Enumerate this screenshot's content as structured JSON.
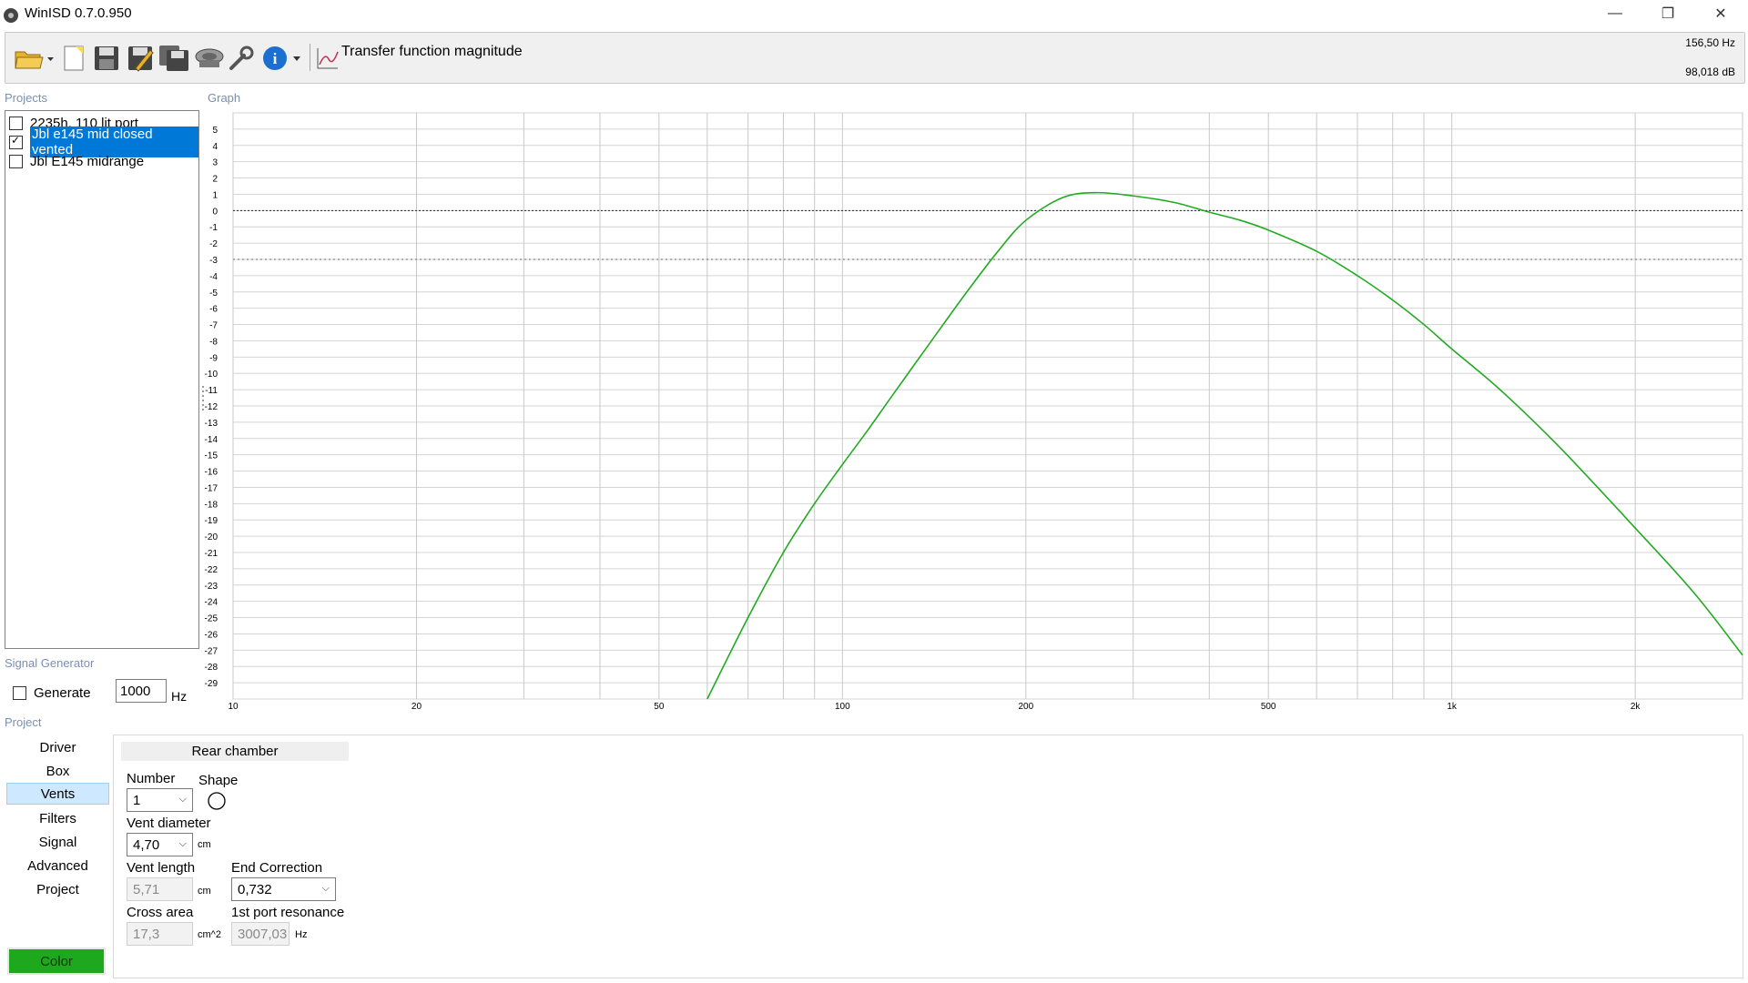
{
  "window": {
    "title": "WinISD 0.7.0.950",
    "minimize": "—",
    "maximize": "❐",
    "close": "✕"
  },
  "toolbar": {
    "graph_type": "Transfer function magnitude",
    "readout_freq": "156,50 Hz",
    "readout_db": "98,018 dB",
    "icons": [
      "open-folder-icon",
      "new-document-icon",
      "save-icon",
      "save-as-icon",
      "save-all-icon",
      "driver-icon",
      "tools-icon",
      "info-icon",
      "graph-type-icon"
    ]
  },
  "projects": {
    "label": "Projects",
    "items": [
      {
        "name": "2235h. 110 lit port",
        "checked": false,
        "selected": false
      },
      {
        "name": "Jbl e145 mid closed vented",
        "checked": true,
        "selected": true
      },
      {
        "name": "Jbl E145 midrange",
        "checked": false,
        "selected": false
      }
    ]
  },
  "graph": {
    "label": "Graph",
    "line_color": "#22aa22"
  },
  "signal_generator": {
    "label": "Signal Generator",
    "generate_label": "Generate",
    "frequency": "1000",
    "unit": "Hz"
  },
  "project_panel": {
    "label": "Project",
    "nav": [
      "Driver",
      "Box",
      "Vents",
      "Filters",
      "Signal",
      "Advanced",
      "Project"
    ],
    "active": "Vents",
    "color_button": "Color",
    "color_value": "#1ea81e"
  },
  "vents": {
    "header": "Rear chamber",
    "number_label": "Number",
    "number_value": "1",
    "shape_label": "Shape",
    "diameter_label": "Vent diameter",
    "diameter_value": "4,70",
    "diameter_unit": "cm",
    "length_label": "Vent length",
    "length_value": "5,71",
    "length_unit": "cm",
    "end_correction_label": "End Correction",
    "end_correction_value": "0,732",
    "cross_area_label": "Cross area",
    "cross_area_value": "17,3",
    "cross_area_unit": "cm^2",
    "port_res_label": "1st port resonance",
    "port_res_value": "3007,03",
    "port_res_unit": "Hz"
  },
  "chart_data": {
    "type": "line",
    "title": "",
    "xlabel": "",
    "ylabel": "",
    "x_scale": "log",
    "xlim": [
      10,
      3000
    ],
    "ylim": [
      -30,
      6
    ],
    "y_ticks": [
      5,
      4,
      3,
      2,
      1,
      0,
      -1,
      -2,
      -3,
      -4,
      -5,
      -6,
      -7,
      -8,
      -9,
      -10,
      -11,
      -12,
      -13,
      -14,
      -15,
      -16,
      -17,
      -18,
      -19,
      -20,
      -21,
      -22,
      -23,
      -24,
      -25,
      -26,
      -27,
      -28,
      -29
    ],
    "x_ticks": [
      {
        "value": 10,
        "label": "10"
      },
      {
        "value": 20,
        "label": "20"
      },
      {
        "value": 50,
        "label": "50"
      },
      {
        "value": 100,
        "label": "100"
      },
      {
        "value": 200,
        "label": "200"
      },
      {
        "value": 500,
        "label": "500"
      },
      {
        "value": 1000,
        "label": "1k"
      },
      {
        "value": 2000,
        "label": "2k"
      }
    ],
    "reference_lines": [
      0,
      -3
    ],
    "grid": true,
    "series": [
      {
        "color": "#22aa22",
        "x": [
          60,
          70,
          80,
          90,
          100,
          110,
          120,
          140,
          160,
          180,
          200,
          230,
          260,
          300,
          350,
          400,
          450,
          500,
          600,
          700,
          800,
          900,
          1000,
          1200,
          1500,
          2000,
          2500,
          3000
        ],
        "y": [
          -30,
          -25,
          -21,
          -18,
          -15.6,
          -13.5,
          -11.5,
          -8,
          -5,
          -2.5,
          -0.6,
          0.8,
          1.1,
          0.9,
          0.5,
          -0.1,
          -0.6,
          -1.2,
          -2.5,
          -4,
          -5.5,
          -7,
          -8.5,
          -11,
          -14.5,
          -19.5,
          -23.5,
          -27.3
        ]
      }
    ]
  }
}
